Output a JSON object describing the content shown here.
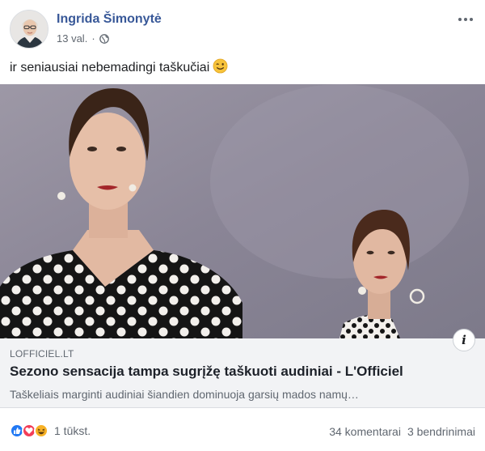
{
  "post": {
    "author": "Ingrida Šimonytė",
    "time": "13 val.",
    "separator": "·",
    "text": "ir seniausiai nebemadingi taškučiai",
    "emoji": "wink-emoji"
  },
  "link": {
    "domain": "LOFFICIEL.LT",
    "title": "Sezono sensacija tampa sugrįžę taškuoti audiniai - L'Officiel",
    "description": "Taškeliais marginti audiniai šiandien dominuoja garsių mados namų…"
  },
  "reactions": {
    "types": [
      "like-icon",
      "love-icon",
      "haha-icon"
    ],
    "count": "1 tūkst.",
    "comments": "34 komentarai",
    "shares": "3 bendrinimai"
  },
  "colors": {
    "author": "#385898",
    "like": "#2078f4",
    "love": "#f33e58",
    "haha": "#f7b125",
    "link_bg": "#f2f3f5"
  }
}
